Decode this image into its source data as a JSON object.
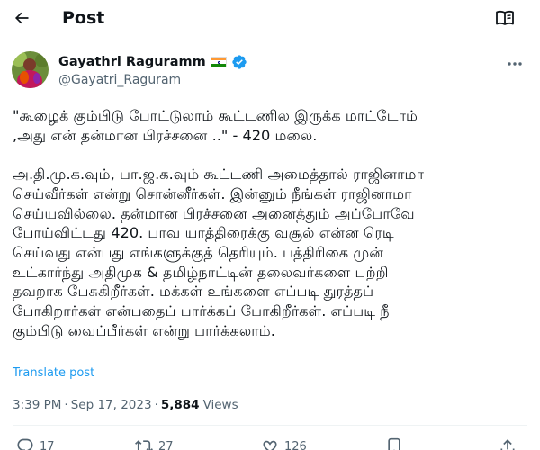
{
  "header": {
    "title": "Post",
    "back_icon": "arrow-left-icon",
    "reader_icon": "reader-mode-icon"
  },
  "author": {
    "name": "Gayathri Raguramm",
    "flag": "🇮🇳",
    "handle": "@Gayatri_Raguram",
    "verified_color": "#1d9bf0"
  },
  "post": {
    "text": "\"கூழைக் கும்பிடு போட்டுலாம் கூட்டணில இருக்க மாட்டோம்\n,அது என் தன்மான பிரச்சனை ..\" - 420 மலை.\n\nஅ.தி.மு.க.வும், பா.ஜ.க.வும் கூட்டணி அமைத்தால் ராஜினாமா\nசெய்வீர்கள் என்று சொன்னீர்கள். இன்னும் நீங்கள் ராஜினாமா\nசெய்யவில்லை. தன்மான பிரச்சனை அனைத்தும் அப்போவே\nபோய்விட்டது 420. பாவ யாத்திரைக்கு வசூல் என்ன ரெடி\nசெய்வது என்பது எங்களுக்குத் தெரியும். பத்திரிகை முன்\nஉட்கார்ந்து அதிமுக & தமிழ்நாட்டின் தலைவர்களை பற்றி\nதவறாக பேசுகிறீர்கள். மக்கள் உங்களை எப்படி துரத்தப்\nபோகிறார்கள் என்பதைப் பார்க்கப் போகிறீர்கள். எப்படி நீ\nகும்பிடு வைப்பீர்கள் என்று பார்க்கலாம்.",
    "translate_label": "Translate post"
  },
  "meta": {
    "time": "3:39 PM",
    "dot1": "·",
    "date": "Sep 17, 2023",
    "dot2": "·",
    "views_count": "5,884",
    "views_label": "Views"
  },
  "actions": {
    "reply_count": "17",
    "repost_count": "27",
    "like_count": "126",
    "icons": [
      "reply-icon",
      "repost-icon",
      "like-icon",
      "bookmark-icon",
      "share-icon"
    ]
  },
  "colors": {
    "accent": "#1d9bf0",
    "text": "#0f1419",
    "muted": "#536471",
    "divider": "#eff3f4"
  }
}
